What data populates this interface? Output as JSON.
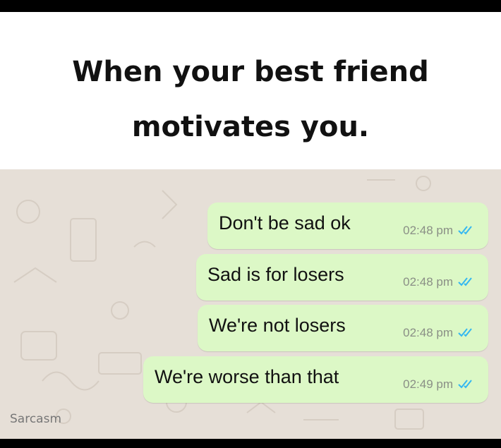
{
  "caption": {
    "line1": "When your best friend",
    "line2": "motivates you."
  },
  "messages": [
    {
      "text": "Don't be sad ok",
      "time": "02:48 pm",
      "status_icon": "double-check-read-icon"
    },
    {
      "text": "Sad is for losers",
      "time": "02:48 pm",
      "status_icon": "double-check-read-icon"
    },
    {
      "text": "We're not losers",
      "time": "02:48 pm",
      "status_icon": "double-check-read-icon"
    },
    {
      "text": "We're worse than that",
      "time": "02:49 pm",
      "status_icon": "double-check-read-icon"
    }
  ],
  "watermark": "Sarcasm",
  "colors": {
    "caption_background": "#ffffff",
    "chat_background": "#e6dfd7",
    "bubble": "#dcf8c6",
    "read_ticks": "#34b7f1",
    "frame": "#000000"
  }
}
